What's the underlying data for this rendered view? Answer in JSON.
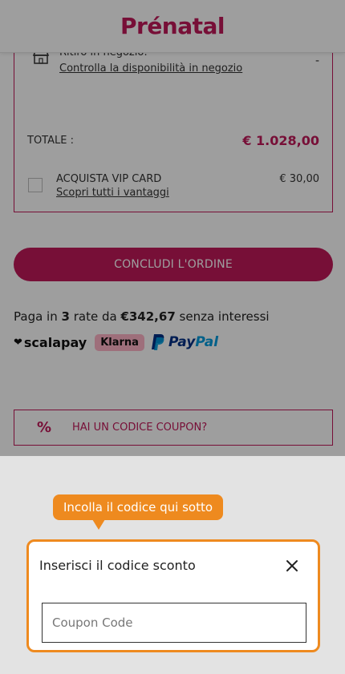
{
  "header": {
    "logo": "Prénatal"
  },
  "summary": {
    "store_title": "Ritiro in negozio:",
    "store_link": "Controlla la disponibilità in negozio",
    "store_value": "-",
    "total_label": "TOTALE :",
    "total_value": "€ 1.028,00",
    "vip_title": "ACQUISTA VIP CARD",
    "vip_link": "Scopri tutti i vantaggi",
    "vip_price": "€ 30,00"
  },
  "conclude_label": "CONCLUDI L'ORDINE",
  "installments": {
    "prefix": "Paga in ",
    "count": "3",
    "middle": " rate da ",
    "amount": "€342,67",
    "suffix": " senza interessi",
    "scalapay": "scalapay",
    "klarna": "Klarna",
    "paypal_pay": "Pay",
    "paypal_pal": "Pal"
  },
  "coupon": {
    "icon": "percent-icon",
    "label": "HAI UN CODICE COUPON?"
  },
  "tooltip": {
    "text": "Incolla il codice qui sotto"
  },
  "dialog": {
    "title": "Inserisci il codice sconto",
    "placeholder": "Coupon Code",
    "value": ""
  },
  "colors": {
    "brand": "#c0195a",
    "tooltip": "#ee8a1f",
    "overlay": "rgba(0,0,0,0.38)"
  }
}
